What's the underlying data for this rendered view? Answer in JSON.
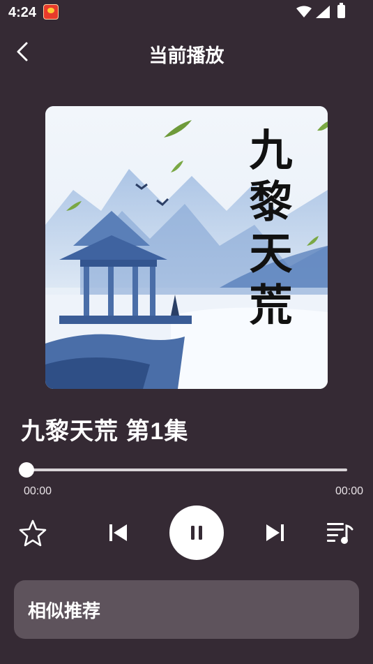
{
  "status_bar": {
    "time": "4:24"
  },
  "header": {
    "title": "当前播放"
  },
  "cover": {
    "text": "九黎天荒"
  },
  "track": {
    "title": "九黎天荒 第1集"
  },
  "player": {
    "current_time": "00:00",
    "total_time": "00:00",
    "progress": 0,
    "state": "playing"
  },
  "controls": [
    "star-icon",
    "skip-previous-icon",
    "pause-icon",
    "skip-next-icon",
    "playlist-icon"
  ],
  "recommend": {
    "title": "相似推荐"
  },
  "colors": {
    "background": "#352a34",
    "card": "#5e535c",
    "accent": "#ffffff"
  }
}
